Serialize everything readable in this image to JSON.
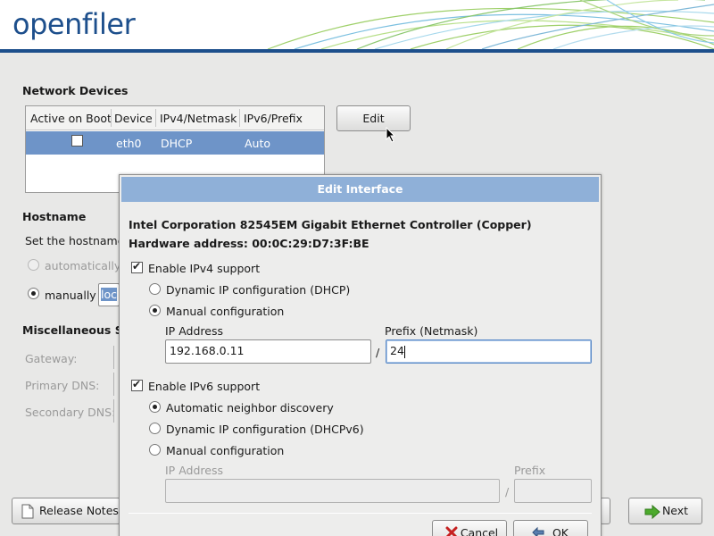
{
  "header": {
    "logo": "openfiler",
    "accent": "#1d4f8c"
  },
  "network": {
    "title": "Network Devices",
    "columns": [
      "Active on Boot",
      "Device",
      "IPv4/Netmask",
      "IPv6/Prefix"
    ],
    "rows": [
      {
        "active": false,
        "device": "eth0",
        "ipv4": "DHCP",
        "ipv6": "Auto"
      }
    ],
    "edit_label": "Edit"
  },
  "hostname": {
    "title": "Hostname",
    "desc": "Set the hostname",
    "auto_label": "automatically",
    "manual_label": "manually",
    "value": "loc"
  },
  "misc": {
    "title": "Miscellaneous Se",
    "gateway_label": "Gateway:",
    "primary_dns_label": "Primary DNS:",
    "secondary_dns_label": "Secondary DNS:"
  },
  "footer": {
    "release_notes": "Release Notes",
    "next": "Next"
  },
  "dialog": {
    "title": "Edit Interface",
    "device_desc": "Intel Corporation 82545EM Gigabit Ethernet Controller (Copper)",
    "hw_address": "Hardware address: 00:0C:29:D7:3F:BE",
    "ipv4": {
      "enable_label": "Enable IPv4 support",
      "enabled": true,
      "dhcp_label": "Dynamic IP configuration (DHCP)",
      "manual_label": "Manual configuration",
      "selected": "manual",
      "ip_label": "IP Address",
      "prefix_label": "Prefix (Netmask)",
      "ip_value": "192.168.0.11",
      "prefix_value": "24",
      "slash": "/"
    },
    "ipv6": {
      "enable_label": "Enable IPv6 support",
      "enabled": true,
      "auto_label": "Automatic neighbor discovery",
      "dhcp_label": "Dynamic IP configuration (DHCPv6)",
      "manual_label": "Manual configuration",
      "selected": "auto",
      "ip_label": "IP Address",
      "prefix_label": "Prefix",
      "slash": "/"
    },
    "cancel_label": "Cancel",
    "ok_label": "OK"
  }
}
